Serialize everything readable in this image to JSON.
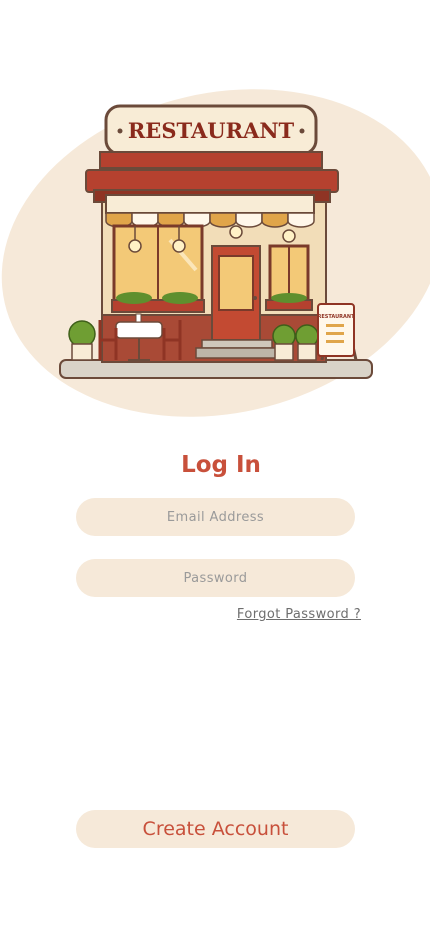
{
  "hero": {
    "sign_text": "RESTAURANT",
    "board_text": "RESTAURANT",
    "accent_color": "#c8503b",
    "cream_color": "#f6e9d9"
  },
  "login": {
    "title": "Log In",
    "email_placeholder": "Email Address",
    "password_placeholder": "Password",
    "forgot_label": "Forgot Password ?",
    "create_account_label": "Create Account"
  }
}
